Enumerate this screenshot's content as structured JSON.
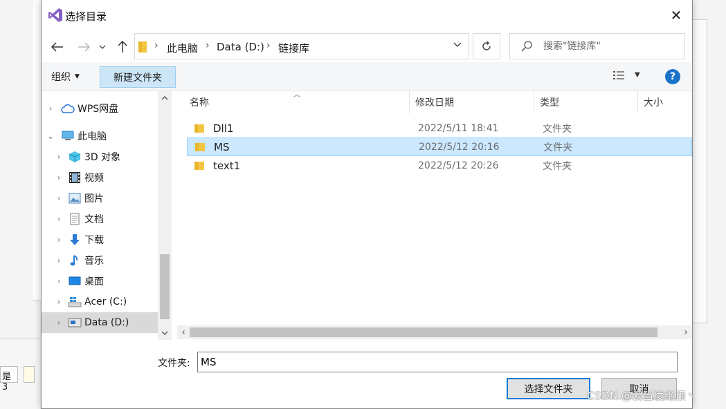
{
  "dialog": {
    "title": "选择目录",
    "close_symbol": "✕"
  },
  "address": {
    "crumbs": [
      "此电脑",
      "Data (D:)",
      "链接库"
    ],
    "search_placeholder": "搜索\"链接库\""
  },
  "toolbar": {
    "organize_label": "组织",
    "new_folder_label": "新建文件夹"
  },
  "nav": {
    "items": [
      {
        "label": "WPS网盘",
        "icon": "cloud-icon"
      },
      {
        "label": "此电脑",
        "icon": "computer-icon"
      },
      {
        "label": "3D 对象",
        "icon": "cube-icon"
      },
      {
        "label": "视频",
        "icon": "film-icon"
      },
      {
        "label": "图片",
        "icon": "picture-icon"
      },
      {
        "label": "文档",
        "icon": "document-icon"
      },
      {
        "label": "下载",
        "icon": "download-arrow-icon"
      },
      {
        "label": "音乐",
        "icon": "music-note-icon"
      },
      {
        "label": "桌面",
        "icon": "desktop-icon"
      },
      {
        "label": "Acer (C:)",
        "icon": "windows-drive-icon"
      },
      {
        "label": "Data (D:)",
        "icon": "drive-icon",
        "selected": true
      }
    ]
  },
  "filelist": {
    "columns": [
      "名称",
      "修改日期",
      "类型",
      "大小"
    ],
    "rows": [
      {
        "name": "Dll1",
        "date": "2022/5/11 18:41",
        "type": "文件夹",
        "selected": false
      },
      {
        "name": "MS",
        "date": "2022/5/12 20:16",
        "type": "文件夹",
        "selected": true
      },
      {
        "name": "text1",
        "date": "2022/5/12 20:26",
        "type": "文件夹",
        "selected": false
      }
    ]
  },
  "bottom": {
    "folder_label": "文件夹:",
    "folder_value": "MS",
    "ok_label": "选择文件夹",
    "cancel_label": "取消"
  },
  "background": {
    "tab_label": "是 3"
  },
  "watermark": "CSDN @云当凌绝顶丶",
  "colors": {
    "accent": "#0078d7",
    "selection": "#cce8ff",
    "folder": "#f4c542"
  }
}
